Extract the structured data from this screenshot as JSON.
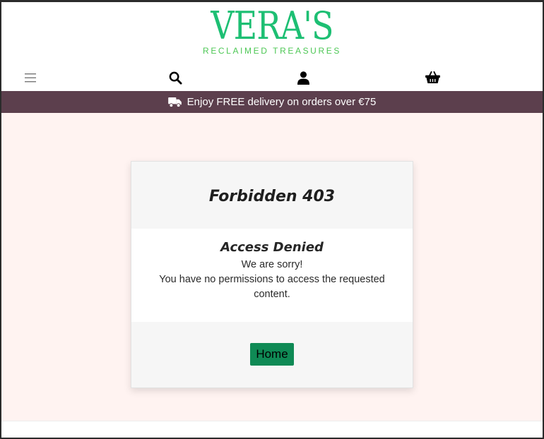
{
  "brand": {
    "name": "VERA'S",
    "tagline": "RECLAIMED TREASURES",
    "color": "#1dbf73"
  },
  "nav": {
    "icons": [
      "menu-icon",
      "search-icon",
      "account-icon",
      "basket-icon"
    ]
  },
  "banner": {
    "text": "Enjoy FREE delivery on orders over €75",
    "icon": "truck-icon",
    "background": "#5c3f4d"
  },
  "error_card": {
    "title": "Forbidden 403",
    "subtitle": "Access Denied",
    "line1": "We are sorry!",
    "line2": "You have no permissions to access the requested content.",
    "button_label": "Home",
    "button_color": "#0f8a55"
  },
  "colors": {
    "page_background": "#fff3f1"
  }
}
